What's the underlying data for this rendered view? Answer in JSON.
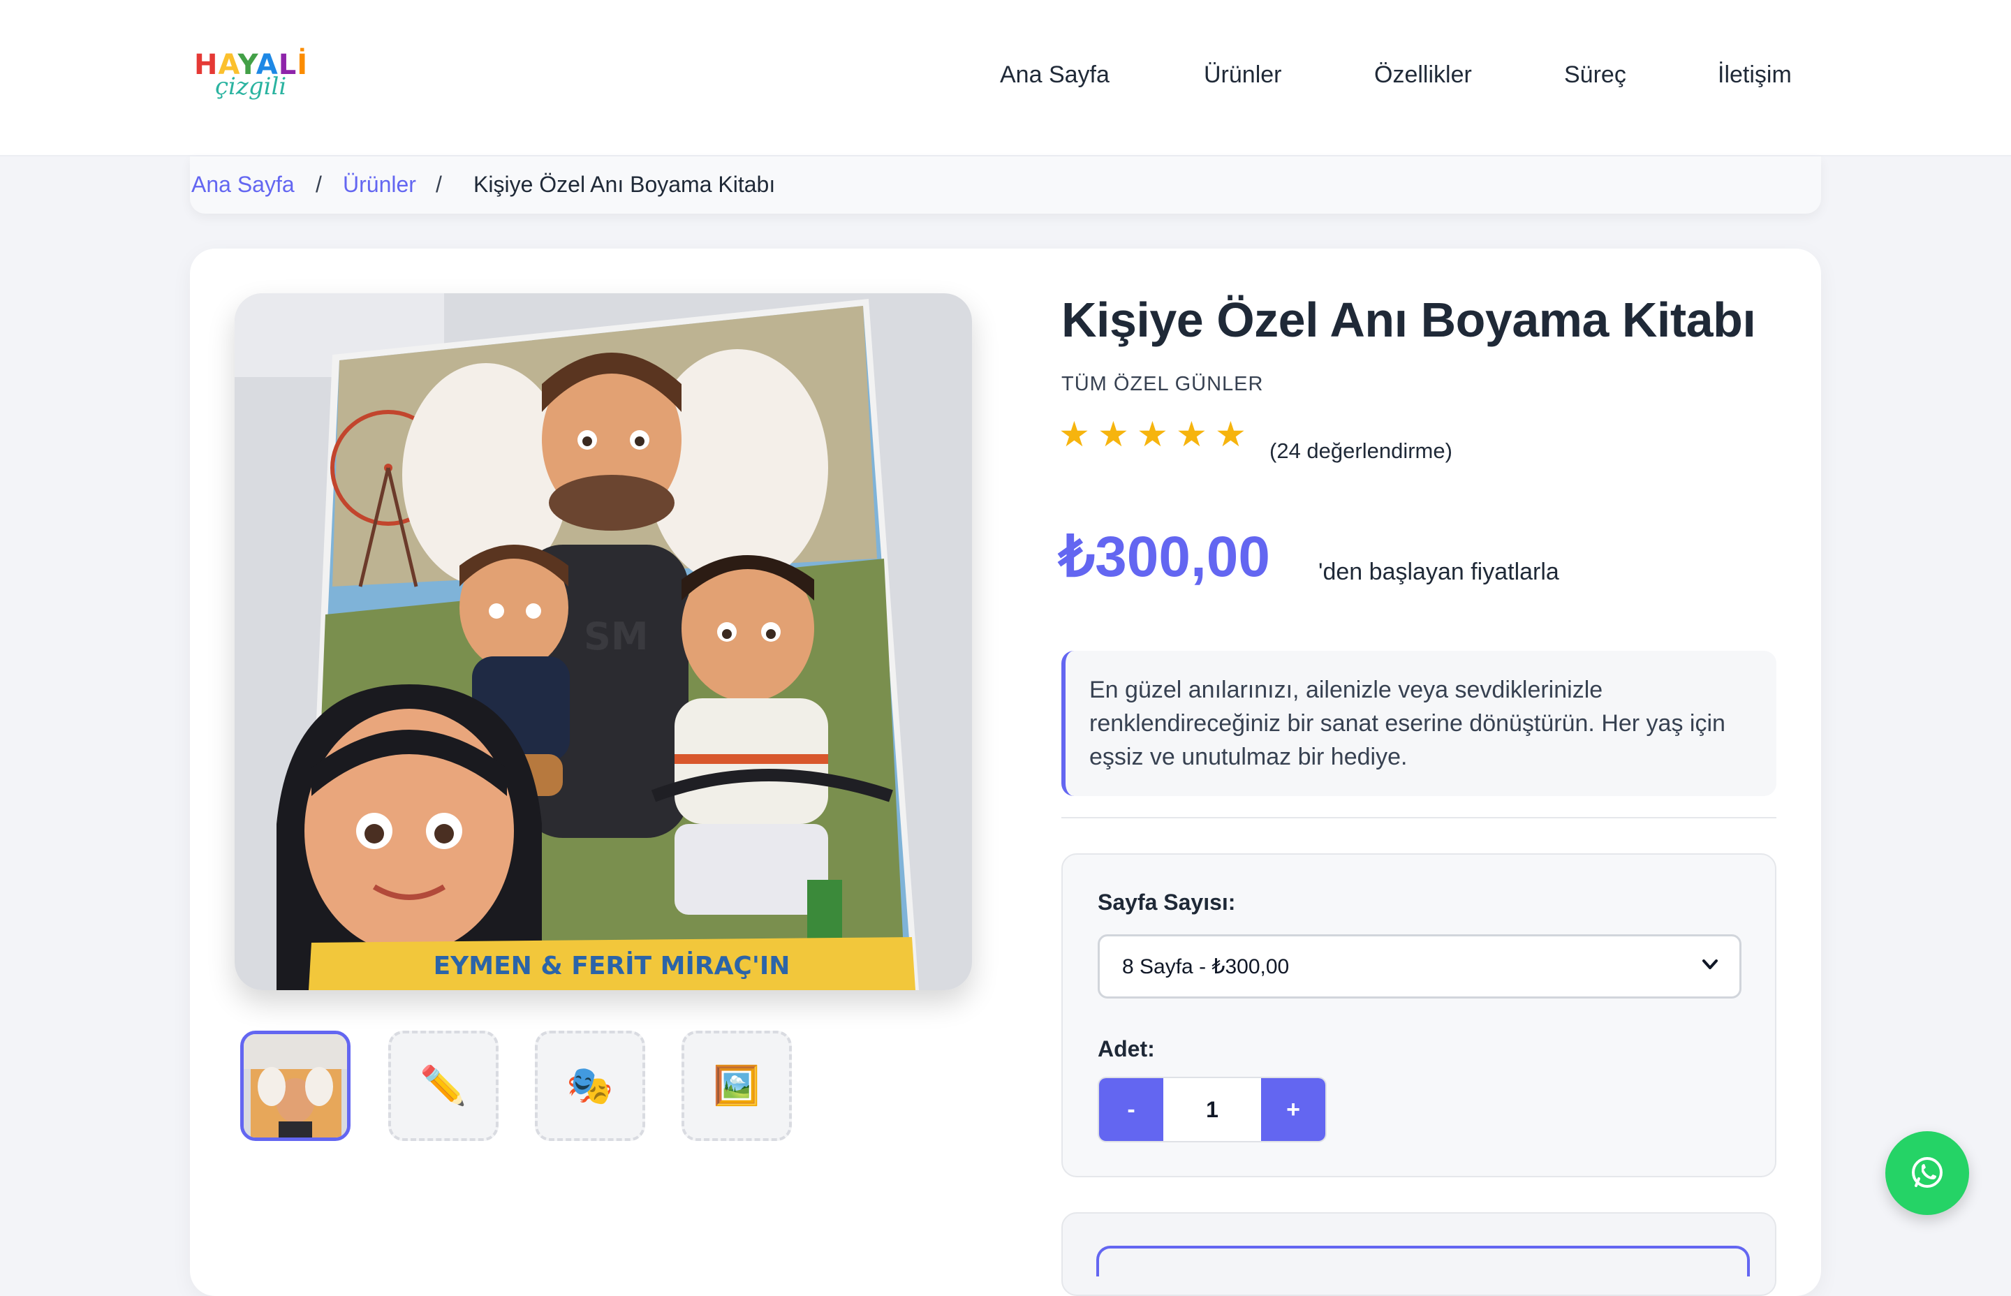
{
  "brand": {
    "logo_line1": "HAYALİ",
    "logo_line2": "çizgili",
    "logo_colors": [
      "#e53935",
      "#fbc02d",
      "#43a047",
      "#1e88e5",
      "#8e24aa",
      "#fb8c00"
    ]
  },
  "nav": {
    "items": [
      "Ana Sayfa",
      "Ürünler",
      "Özellikler",
      "Süreç",
      "İletişim"
    ]
  },
  "breadcrumb": {
    "home": "Ana Sayfa",
    "separator": "/",
    "products": "Ürünler",
    "current": "Kişiye Özel Anı Boyama Kitabı"
  },
  "product": {
    "title": "Kişiye Özel Anı Boyama Kitabı",
    "category": "TÜM ÖZEL GÜNLER",
    "rating_stars": 5,
    "reviews": "(24 değerlendirme)",
    "price": "₺300,00",
    "price_suffix": "'den başlayan fiyatlarla",
    "description": "En güzel anılarınızı, ailenizle veya sevdiklerinizle renklendireceğiniz bir sanat eserine dönüştürün. Her yaş için eşsiz ve unutulmaz bir hediye.",
    "cover_banner": "EYMEN & FERİT MİRAÇ'IN",
    "shirt_text": "SM"
  },
  "thumbnails": [
    {
      "type": "photo",
      "icon": "cover-photo"
    },
    {
      "type": "emoji",
      "icon": "pencil-icon",
      "glyph": "✏️"
    },
    {
      "type": "emoji",
      "icon": "theater-masks-icon",
      "glyph": "🎭"
    },
    {
      "type": "emoji",
      "icon": "framed-picture-icon",
      "glyph": "🖼️"
    }
  ],
  "options": {
    "page_label": "Sayfa Sayısı:",
    "page_selected": "8 Sayfa - ₺300,00",
    "qty_label": "Adet:",
    "qty_minus": "-",
    "qty_value": "1",
    "qty_plus": "+"
  },
  "colors": {
    "accent": "#6366f1",
    "star": "#f6b40e",
    "whatsapp": "#25d366"
  },
  "widgets": {
    "whatsapp_icon": "whatsapp-icon"
  }
}
